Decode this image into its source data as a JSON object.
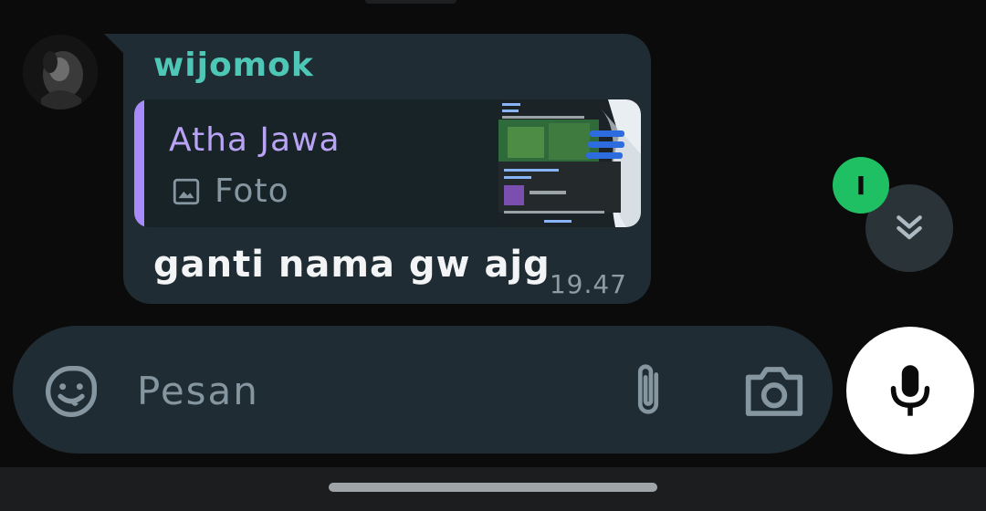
{
  "message": {
    "sender": "wijomok",
    "reply_to": {
      "name": "Atha Jawa",
      "type_label": "Foto"
    },
    "text": "ganti nama gw ajg",
    "time": "19.47"
  },
  "unread_badge": "I",
  "composer": {
    "placeholder": "Pesan"
  },
  "icons": {
    "emoji": "sticker-smile-icon",
    "attach": "paperclip-icon",
    "camera": "camera-icon",
    "mic": "microphone-icon",
    "scroll": "double-chevron-down-icon",
    "photo": "image-icon"
  },
  "colors": {
    "background": "#0b0b0c",
    "bubble": "#202c33",
    "sender": "#4fc7b6",
    "quote_accent": "#a78bfa",
    "badge": "#1fbf63"
  }
}
